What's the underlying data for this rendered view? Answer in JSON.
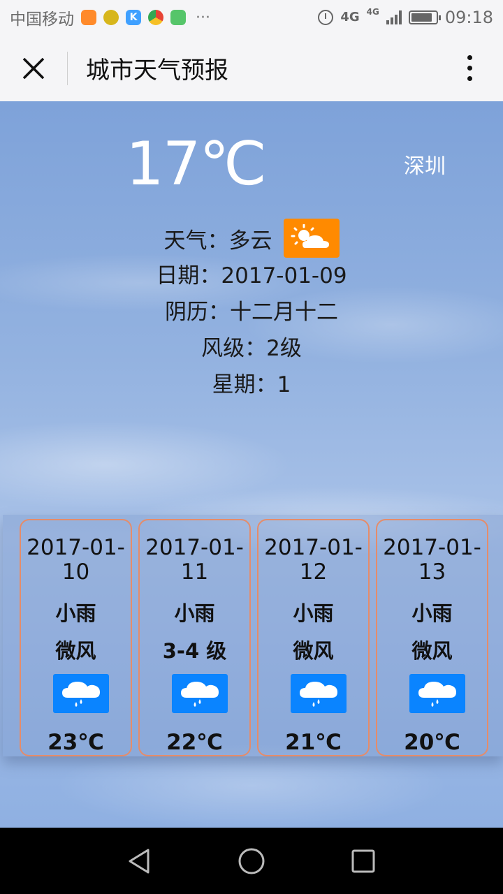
{
  "status_bar": {
    "carrier": "中国移动",
    "dots": "···",
    "network": "4G",
    "network2": "4G",
    "time": "09:18"
  },
  "titlebar": {
    "title": "城市天气预报"
  },
  "today": {
    "temperature": "17℃",
    "city": "深圳",
    "weather": "天气：多云",
    "date": "日期：2017-01-09",
    "lunar": "阴历：十二月十二",
    "wind": "风级：2级",
    "weekday": "星期：1",
    "icon": "partly-cloudy-icon",
    "icon_color": "#ff8a00"
  },
  "forecast": [
    {
      "date": "2017-01-10",
      "condition": "小雨",
      "wind": "微风",
      "temp": "23℃",
      "icon": "light-rain-icon"
    },
    {
      "date": "2017-01-11",
      "condition": "小雨",
      "wind": "3-4 级",
      "temp": "22℃",
      "icon": "light-rain-icon"
    },
    {
      "date": "2017-01-12",
      "condition": "小雨",
      "wind": "微风",
      "temp": "21℃",
      "icon": "light-rain-icon"
    },
    {
      "date": "2017-01-13",
      "condition": "小雨",
      "wind": "微风",
      "temp": "20℃",
      "icon": "light-rain-icon"
    }
  ],
  "colors": {
    "card_border": "#e58c6a",
    "rain_icon_bg": "#0a84ff"
  }
}
